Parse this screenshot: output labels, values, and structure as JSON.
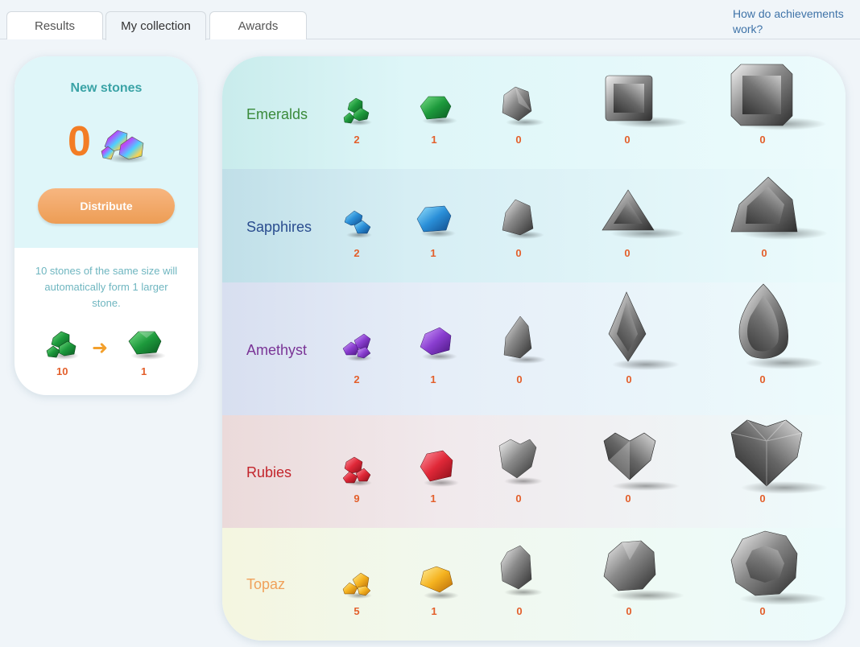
{
  "tabs": [
    {
      "label": "Results"
    },
    {
      "label": "My collection"
    },
    {
      "label": "Awards"
    }
  ],
  "help_link": "How do achievements work?",
  "left_panel": {
    "title": "New stones",
    "count": "0",
    "button": "Distribute",
    "info": "10 stones of the same size will automatically form 1 larger stone.",
    "merge_from": "10",
    "merge_to": "1"
  },
  "rows": [
    {
      "name": "Emeralds",
      "counts": [
        "2",
        "1",
        "0",
        "0",
        "0"
      ],
      "color": "#3a8a3a"
    },
    {
      "name": "Sapphires",
      "counts": [
        "2",
        "1",
        "0",
        "0",
        "0"
      ],
      "color": "#2a4d8f"
    },
    {
      "name": "Amethyst",
      "counts": [
        "2",
        "1",
        "0",
        "0",
        "0"
      ],
      "color": "#7a3496"
    },
    {
      "name": "Rubies",
      "counts": [
        "9",
        "1",
        "0",
        "0",
        "0"
      ],
      "color": "#c3252c"
    },
    {
      "name": "Topaz",
      "counts": [
        "5",
        "1",
        "0",
        "0",
        "0"
      ],
      "color": "#f0a15a"
    }
  ],
  "colors": {
    "accent": "#f37d25",
    "count": "#e35f2b",
    "link": "#3f73a8"
  }
}
